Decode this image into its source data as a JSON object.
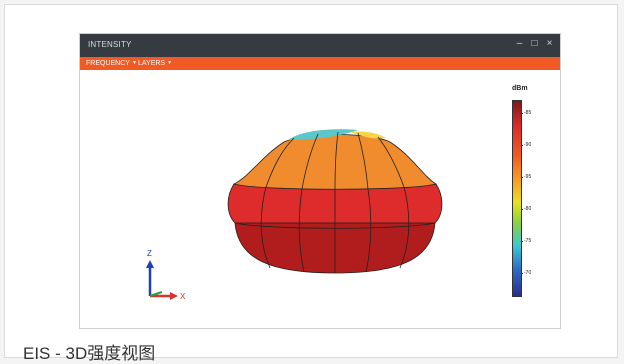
{
  "window": {
    "title": "INTENSITY",
    "controls": [
      {
        "label": "–",
        "icon": "minimize-icon"
      },
      {
        "label": "□",
        "icon": "maximize-icon"
      },
      {
        "label": "×",
        "icon": "close-icon"
      }
    ]
  },
  "menu": {
    "items": [
      {
        "label": "FREQUENCY",
        "icon": "chevron-down-icon"
      },
      {
        "label": "LAYERS",
        "icon": "chevron-down-icon"
      }
    ],
    "bar_color": "#f05a24"
  },
  "legend": {
    "unit": "dBm",
    "ticks": [
      "-85",
      "-90",
      "-95",
      "-80",
      "-75",
      "-70"
    ]
  },
  "axes": {
    "z": "Z",
    "x": "X"
  },
  "caption": "EIS - 3D强度视图",
  "colors": {
    "titlebar": "#353b41",
    "top_cap": "#f08c2e",
    "upper_band": "#de2b2b",
    "lower_band": "#b11d1d",
    "peak": "#5cc7c9"
  }
}
